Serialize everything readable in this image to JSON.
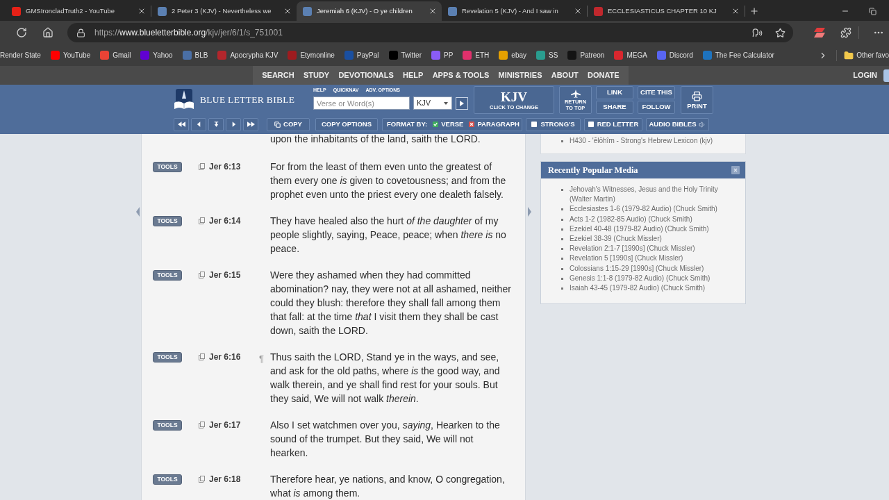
{
  "browser": {
    "tabs": [
      {
        "title": "GMSIroncladTruth2 - YouTube",
        "color": "#e62117",
        "selected": false
      },
      {
        "title": "2 Peter 3 (KJV) - Nevertheless we",
        "color": "#5b80b2",
        "selected": false
      },
      {
        "title": "Jeremiah 6 (KJV) - O ye children",
        "color": "#5b80b2",
        "selected": true
      },
      {
        "title": "Revelation 5 (KJV) - And I saw in",
        "color": "#5b80b2",
        "selected": false
      },
      {
        "title": "ECCLESIASTICUS CHAPTER 10 KJ",
        "color": "#c0282d",
        "selected": false
      }
    ],
    "url": "https://**www.blueletterbible.org**/kjv/jer/6/1/s_751001",
    "bookmarks": [
      {
        "label": "Render State"
      },
      {
        "label": "YouTube",
        "color": "#ff0000"
      },
      {
        "label": "Gmail",
        "color": "#ea4335"
      },
      {
        "label": "Yahoo",
        "color": "#6001d2"
      },
      {
        "label": "BLB",
        "color": "#4a6fa5"
      },
      {
        "label": "Apocrypha KJV",
        "color": "#b3262c"
      },
      {
        "label": "Etymonline",
        "color": "#9e1b1f"
      },
      {
        "label": "PayPal",
        "color": "#1a4fa0"
      },
      {
        "label": "Twitter",
        "color": "#000000"
      },
      {
        "label": "PP",
        "color": "#8a5cf6"
      },
      {
        "label": "ETH",
        "color": "#e1306c"
      },
      {
        "label": "ebay",
        "color": "#e5a000"
      },
      {
        "label": "SS",
        "color": "#2a9d8f"
      },
      {
        "label": "Patreon",
        "color": "#141414"
      },
      {
        "label": "MEGA",
        "color": "#d9272e"
      },
      {
        "label": "Discord",
        "color": "#5865f2"
      },
      {
        "label": "The Fee Calculator",
        "color": "#1e73be"
      }
    ],
    "other_favorites": "Other favo"
  },
  "site": {
    "nav": [
      "SEARCH",
      "STUDY",
      "DEVOTIONALS",
      "HELP",
      "APPS & TOOLS",
      "MINISTRIES",
      "ABOUT",
      "DONATE"
    ],
    "login": "LOGIN",
    "logo": "BLUE LETTER BIBLE",
    "search_links": [
      "HELP",
      "QUICKNAV",
      "ADV. OPTIONS"
    ],
    "search": {
      "placeholder": "Verse or Word(s)"
    },
    "version_select": "KJV",
    "version_button": {
      "label": "KJV",
      "sublabel": "CLICK TO CHANGE"
    },
    "return_to_top": "RETURN TO TOP",
    "actions": [
      [
        "LINK",
        "SHARE"
      ],
      [
        "CITE THIS",
        "FOLLOW"
      ]
    ],
    "print": "PRINT",
    "toolbar": {
      "copy": "COPY",
      "copy_options": "COPY OPTIONS",
      "format_by": "FORMAT BY:",
      "formats": [
        {
          "label": "VERSE",
          "selected": true
        },
        {
          "label": "PARAGRAPH",
          "selected": false
        }
      ],
      "toggles": [
        {
          "label": "STRONG'S",
          "checked": false
        },
        {
          "label": "RED LETTER",
          "checked": false
        }
      ],
      "audio": "AUDIO BIBLES"
    }
  },
  "reader": {
    "continued_text": "upon the inhabitants of the land, saith the LORD.",
    "verses": [
      {
        "tools": "TOOLS",
        "ref": "Jer 6:13",
        "text": "For from the least of them even unto the greatest of them every one *is* given to covetousness; and from the prophet even unto the priest every one dealeth falsely."
      },
      {
        "tools": "TOOLS",
        "ref": "Jer 6:14",
        "text": "They have healed also the hurt *of the daughter* of my people slightly, saying, Peace, peace; when *there is* no peace."
      },
      {
        "tools": "TOOLS",
        "ref": "Jer 6:15",
        "text": "Were they ashamed when they had committed abomination? nay, they were not at all ashamed, neither could they blush: therefore they shall fall among them that fall: at the time *that* I visit them they shall be cast down, saith the LORD."
      },
      {
        "tools": "TOOLS",
        "ref": "Jer 6:16",
        "pilcrow": "¶",
        "text": "Thus saith the LORD, Stand ye in the ways, and see, and ask for the old paths, where *is* the good way, and walk therein, and ye shall find rest for your souls. But they said, We will not walk *therein*."
      },
      {
        "tools": "TOOLS",
        "ref": "Jer 6:17",
        "text": "Also I set watchmen over you, *saying*, Hearken to the sound of the trumpet. But they said, We will not hearken."
      },
      {
        "tools": "TOOLS",
        "ref": "Jer 6:18",
        "text": "Therefore hear, ye nations, and know, O congregation, what *is* among them."
      }
    ]
  },
  "sidebar": {
    "lexicon": [
      "H430 - 'ĕlōhîm - Strong's Hebrew Lexicon (kjv)"
    ],
    "media": {
      "title": "Recently Popular Media",
      "items": [
        "Jehovah's Witnesses, Jesus and the Holy Trinity (Walter Martin)",
        "Ecclesiastes 1-6 (1979-82 Audio) (Chuck Smith)",
        "Acts 1-2 (1982-85 Audio) (Chuck Smith)",
        "Ezekiel 40-48 (1979-82 Audio) (Chuck Smith)",
        "Ezekiel 38-39 (Chuck Missler)",
        "Revelation 2:1-7 [1990s] (Chuck Missler)",
        "Revelation 5 [1990s] (Chuck Missler)",
        "Colossians 1:15-29 [1990s] (Chuck Missler)",
        "Genesis 1:1-8 (1979-82 Audio) (Chuck Smith)",
        "Isaiah 43-45 (1979-82 Audio) (Chuck Smith)"
      ]
    }
  }
}
